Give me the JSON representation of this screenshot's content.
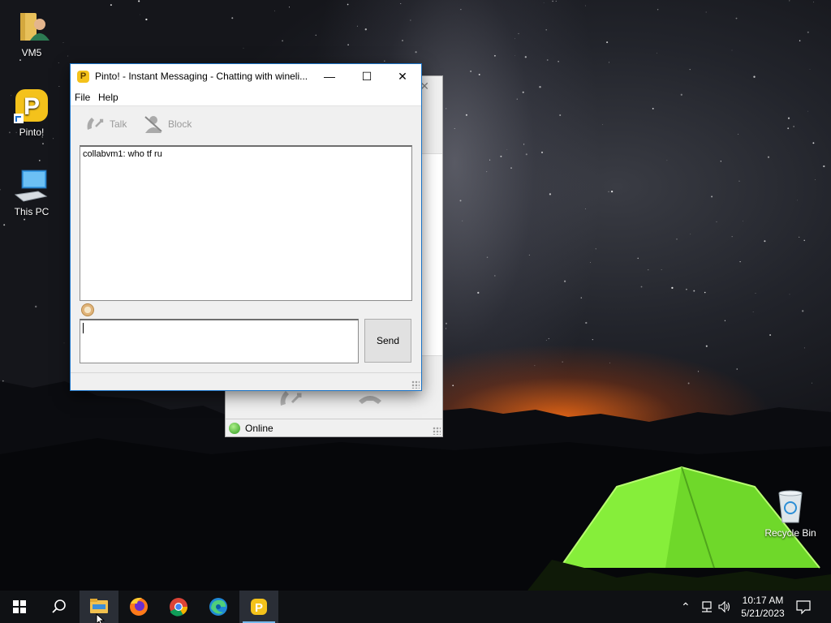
{
  "desktop": {
    "icons": [
      {
        "label": "VM5"
      },
      {
        "label": "Pinto!"
      },
      {
        "label": "This PC"
      },
      {
        "label": "Recycle Bin"
      }
    ]
  },
  "chat_window": {
    "title": "Pinto! - Instant Messaging - Chatting with wineli...",
    "menu": {
      "file": "File",
      "help": "Help"
    },
    "toolbar": {
      "talk": "Talk",
      "block": "Block"
    },
    "messages": [
      "collabvm1: who tf ru"
    ],
    "compose_value": "",
    "send_label": "Send"
  },
  "contact_window": {
    "status": "Online"
  },
  "taskbar": {
    "time": "10:17 AM",
    "date": "5/21/2023"
  },
  "colors": {
    "accent": "#1a73c7",
    "taskbar_bg": "#0f1114",
    "pinto_yellow": "#f4c21b"
  }
}
